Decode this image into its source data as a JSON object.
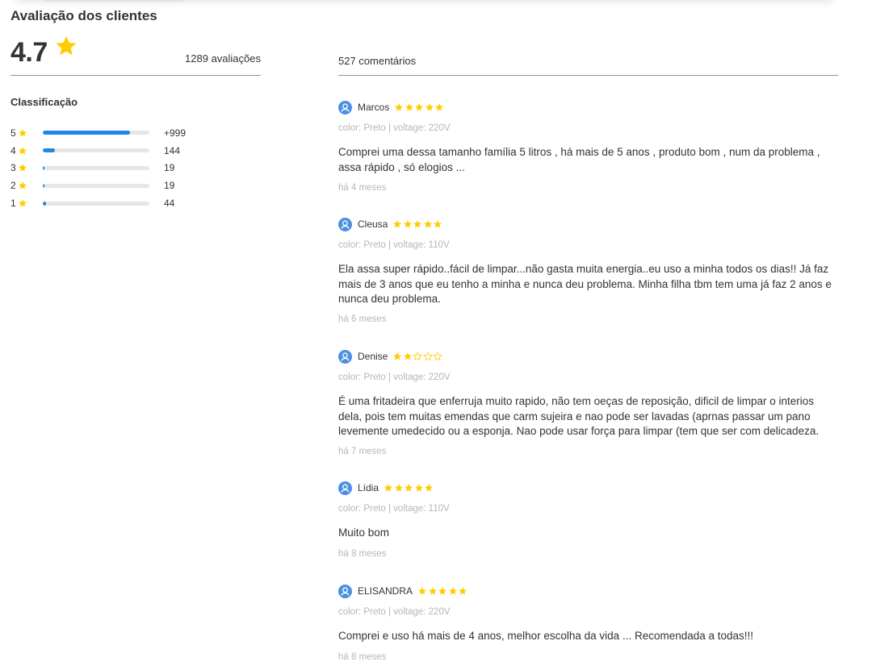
{
  "summary": {
    "title": "Avaliação dos clientes",
    "average": "4.7",
    "total_label": "1289 avaliações",
    "classification_title": "Classificação",
    "accent_color": "#1e88e5",
    "star_color": "#ffcc00",
    "distribution": [
      {
        "stars": "5",
        "count_label": "+999",
        "fraction": 0.82
      },
      {
        "stars": "4",
        "count_label": "144",
        "fraction": 0.11
      },
      {
        "stars": "3",
        "count_label": "19",
        "fraction": 0.015
      },
      {
        "stars": "2",
        "count_label": "19",
        "fraction": 0.015
      },
      {
        "stars": "1",
        "count_label": "44",
        "fraction": 0.034
      }
    ]
  },
  "comments": {
    "count_label": "527 comentários",
    "items": [
      {
        "name": "Marcos",
        "rating": 5,
        "variant": "color: Preto | voltage: 220V",
        "text": "Comprei uma dessa tamanho família 5 litros , há mais de 5 anos , produto bom , num da problema , assa rápido , só elogios ...",
        "date": "há 4 meses"
      },
      {
        "name": "Cleusa",
        "rating": 5,
        "variant": "color: Preto | voltage: 110V",
        "text": "Ela assa super rápido..fácil de limpar...não gasta muita energia..eu uso a minha todos os dias!! Já faz mais de 3 anos que eu tenho a minha e nunca deu problema. Minha filha tbm tem uma já faz 2 anos e nunca deu problema.",
        "date": "há 6 meses"
      },
      {
        "name": "Denise",
        "rating": 2,
        "variant": "color: Preto | voltage: 220V",
        "text": "É uma fritadeira que enferruja muito rapido, não tem oeças de reposição, dificil de limpar o interios dela, pois tem muitas emendas que carm sujeira e nao pode ser lavadas (aprnas passar um pano levemente umedecido ou a esponja. Nao pode usar força para limpar (tem que ser com delicadeza.",
        "date": "há 7 meses"
      },
      {
        "name": "Lídia",
        "rating": 5,
        "variant": "color: Preto | voltage: 110V",
        "text": "Muito bom",
        "date": "há 8 meses"
      },
      {
        "name": "ELISANDRA",
        "rating": 5,
        "variant": "color: Preto | voltage: 220V",
        "text": "Comprei e uso há mais de 4 anos, melhor escolha da vida ... Recomendada a todas!!!",
        "date": "há 8 meses"
      }
    ]
  }
}
